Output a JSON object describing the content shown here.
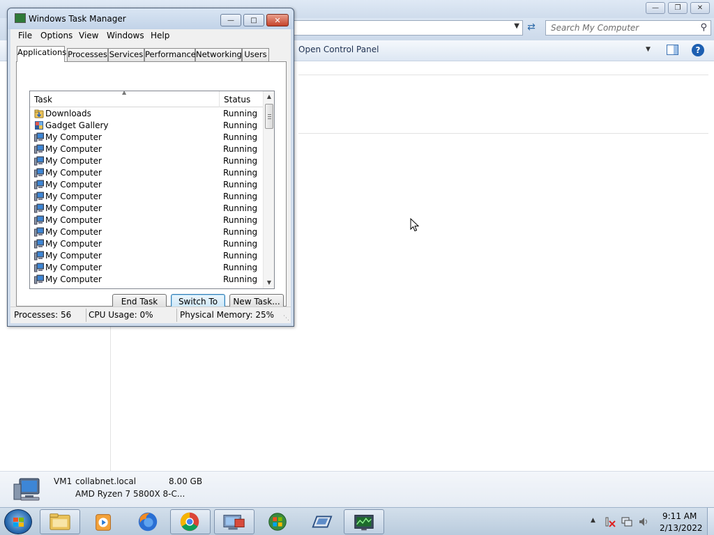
{
  "explorer": {
    "search_placeholder": "Search My Computer",
    "command_label": "Open Control Panel",
    "details": {
      "name": "VM1",
      "domain": "collabnet.local",
      "memory": "8.00 GB",
      "processor": "AMD Ryzen 7 5800X 8-C..."
    }
  },
  "task_manager": {
    "title": "Windows Task Manager",
    "menu": [
      "File",
      "Options",
      "View",
      "Windows",
      "Help"
    ],
    "tabs": [
      "Applications",
      "Processes",
      "Services",
      "Performance",
      "Networking",
      "Users"
    ],
    "active_tab": "Applications",
    "columns": {
      "task": "Task",
      "status": "Status"
    },
    "tasks": [
      {
        "name": "Downloads",
        "status": "Running",
        "icon": "downloads-folder-icon"
      },
      {
        "name": "Gadget Gallery",
        "status": "Running",
        "icon": "gadget-gallery-icon"
      },
      {
        "name": "My Computer",
        "status": "Running",
        "icon": "computer-icon"
      },
      {
        "name": "My Computer",
        "status": "Running",
        "icon": "computer-icon"
      },
      {
        "name": "My Computer",
        "status": "Running",
        "icon": "computer-icon"
      },
      {
        "name": "My Computer",
        "status": "Running",
        "icon": "computer-icon"
      },
      {
        "name": "My Computer",
        "status": "Running",
        "icon": "computer-icon"
      },
      {
        "name": "My Computer",
        "status": "Running",
        "icon": "computer-icon"
      },
      {
        "name": "My Computer",
        "status": "Running",
        "icon": "computer-icon"
      },
      {
        "name": "My Computer",
        "status": "Running",
        "icon": "computer-icon"
      },
      {
        "name": "My Computer",
        "status": "Running",
        "icon": "computer-icon"
      },
      {
        "name": "My Computer",
        "status": "Running",
        "icon": "computer-icon"
      },
      {
        "name": "My Computer",
        "status": "Running",
        "icon": "computer-icon"
      },
      {
        "name": "My Computer",
        "status": "Running",
        "icon": "computer-icon"
      },
      {
        "name": "My Computer",
        "status": "Running",
        "icon": "computer-icon"
      }
    ],
    "buttons": {
      "end_task": "End Task",
      "switch_to": "Switch To",
      "new_task": "New Task..."
    },
    "status_bar": {
      "processes": "Processes: 56",
      "cpu": "CPU Usage: 0%",
      "memory": "Physical Memory: 25%"
    }
  },
  "taskbar": {
    "pinned": [
      "windows-explorer-icon",
      "media-player-icon",
      "firefox-icon",
      "chrome-icon",
      "remote-desktop-icon",
      "windows-update-icon",
      "vmware-icon",
      "task-manager-icon"
    ],
    "clock": {
      "time": "9:11 AM",
      "date": "2/13/2022"
    }
  },
  "colors": {
    "accent": "#1d5fb1",
    "taskbar": "#c3d3e4",
    "close_button": "#c5432b"
  }
}
